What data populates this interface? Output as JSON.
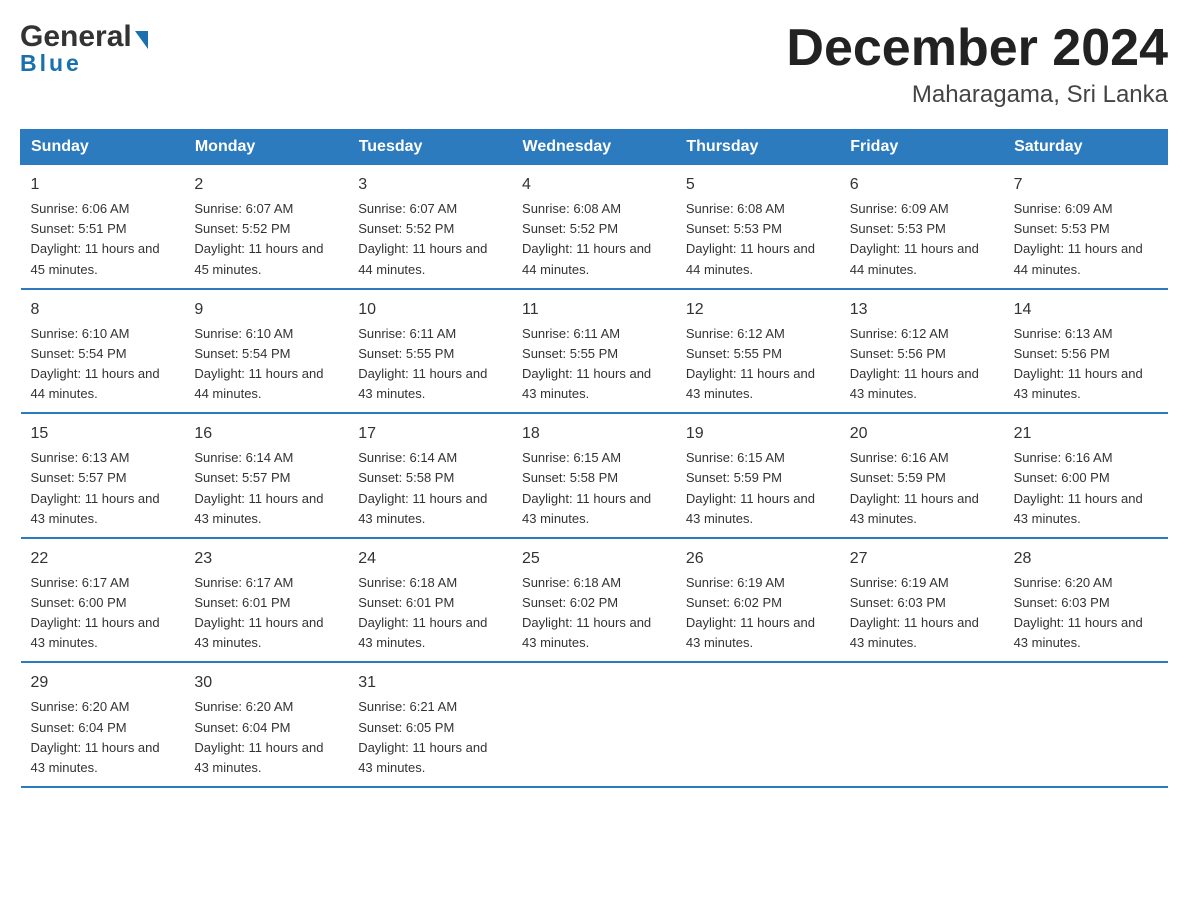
{
  "logo": {
    "general_label": "General",
    "blue_label": "Blue",
    "arrow": "▶"
  },
  "header": {
    "title": "December 2024",
    "subtitle": "Maharagama, Sri Lanka"
  },
  "calendar": {
    "days_of_week": [
      "Sunday",
      "Monday",
      "Tuesday",
      "Wednesday",
      "Thursday",
      "Friday",
      "Saturday"
    ],
    "weeks": [
      [
        {
          "date": "1",
          "sunrise": "6:06 AM",
          "sunset": "5:51 PM",
          "daylight": "11 hours and 45 minutes."
        },
        {
          "date": "2",
          "sunrise": "6:07 AM",
          "sunset": "5:52 PM",
          "daylight": "11 hours and 45 minutes."
        },
        {
          "date": "3",
          "sunrise": "6:07 AM",
          "sunset": "5:52 PM",
          "daylight": "11 hours and 44 minutes."
        },
        {
          "date": "4",
          "sunrise": "6:08 AM",
          "sunset": "5:52 PM",
          "daylight": "11 hours and 44 minutes."
        },
        {
          "date": "5",
          "sunrise": "6:08 AM",
          "sunset": "5:53 PM",
          "daylight": "11 hours and 44 minutes."
        },
        {
          "date": "6",
          "sunrise": "6:09 AM",
          "sunset": "5:53 PM",
          "daylight": "11 hours and 44 minutes."
        },
        {
          "date": "7",
          "sunrise": "6:09 AM",
          "sunset": "5:53 PM",
          "daylight": "11 hours and 44 minutes."
        }
      ],
      [
        {
          "date": "8",
          "sunrise": "6:10 AM",
          "sunset": "5:54 PM",
          "daylight": "11 hours and 44 minutes."
        },
        {
          "date": "9",
          "sunrise": "6:10 AM",
          "sunset": "5:54 PM",
          "daylight": "11 hours and 44 minutes."
        },
        {
          "date": "10",
          "sunrise": "6:11 AM",
          "sunset": "5:55 PM",
          "daylight": "11 hours and 43 minutes."
        },
        {
          "date": "11",
          "sunrise": "6:11 AM",
          "sunset": "5:55 PM",
          "daylight": "11 hours and 43 minutes."
        },
        {
          "date": "12",
          "sunrise": "6:12 AM",
          "sunset": "5:55 PM",
          "daylight": "11 hours and 43 minutes."
        },
        {
          "date": "13",
          "sunrise": "6:12 AM",
          "sunset": "5:56 PM",
          "daylight": "11 hours and 43 minutes."
        },
        {
          "date": "14",
          "sunrise": "6:13 AM",
          "sunset": "5:56 PM",
          "daylight": "11 hours and 43 minutes."
        }
      ],
      [
        {
          "date": "15",
          "sunrise": "6:13 AM",
          "sunset": "5:57 PM",
          "daylight": "11 hours and 43 minutes."
        },
        {
          "date": "16",
          "sunrise": "6:14 AM",
          "sunset": "5:57 PM",
          "daylight": "11 hours and 43 minutes."
        },
        {
          "date": "17",
          "sunrise": "6:14 AM",
          "sunset": "5:58 PM",
          "daylight": "11 hours and 43 minutes."
        },
        {
          "date": "18",
          "sunrise": "6:15 AM",
          "sunset": "5:58 PM",
          "daylight": "11 hours and 43 minutes."
        },
        {
          "date": "19",
          "sunrise": "6:15 AM",
          "sunset": "5:59 PM",
          "daylight": "11 hours and 43 minutes."
        },
        {
          "date": "20",
          "sunrise": "6:16 AM",
          "sunset": "5:59 PM",
          "daylight": "11 hours and 43 minutes."
        },
        {
          "date": "21",
          "sunrise": "6:16 AM",
          "sunset": "6:00 PM",
          "daylight": "11 hours and 43 minutes."
        }
      ],
      [
        {
          "date": "22",
          "sunrise": "6:17 AM",
          "sunset": "6:00 PM",
          "daylight": "11 hours and 43 minutes."
        },
        {
          "date": "23",
          "sunrise": "6:17 AM",
          "sunset": "6:01 PM",
          "daylight": "11 hours and 43 minutes."
        },
        {
          "date": "24",
          "sunrise": "6:18 AM",
          "sunset": "6:01 PM",
          "daylight": "11 hours and 43 minutes."
        },
        {
          "date": "25",
          "sunrise": "6:18 AM",
          "sunset": "6:02 PM",
          "daylight": "11 hours and 43 minutes."
        },
        {
          "date": "26",
          "sunrise": "6:19 AM",
          "sunset": "6:02 PM",
          "daylight": "11 hours and 43 minutes."
        },
        {
          "date": "27",
          "sunrise": "6:19 AM",
          "sunset": "6:03 PM",
          "daylight": "11 hours and 43 minutes."
        },
        {
          "date": "28",
          "sunrise": "6:20 AM",
          "sunset": "6:03 PM",
          "daylight": "11 hours and 43 minutes."
        }
      ],
      [
        {
          "date": "29",
          "sunrise": "6:20 AM",
          "sunset": "6:04 PM",
          "daylight": "11 hours and 43 minutes."
        },
        {
          "date": "30",
          "sunrise": "6:20 AM",
          "sunset": "6:04 PM",
          "daylight": "11 hours and 43 minutes."
        },
        {
          "date": "31",
          "sunrise": "6:21 AM",
          "sunset": "6:05 PM",
          "daylight": "11 hours and 43 minutes."
        },
        null,
        null,
        null,
        null
      ]
    ]
  },
  "labels": {
    "sunrise_prefix": "Sunrise: ",
    "sunset_prefix": "Sunset: ",
    "daylight_prefix": "Daylight: "
  },
  "colors": {
    "header_bg": "#2d7bbf",
    "header_text": "#ffffff",
    "border": "#2d7bbf",
    "logo_blue": "#1a6faf"
  }
}
